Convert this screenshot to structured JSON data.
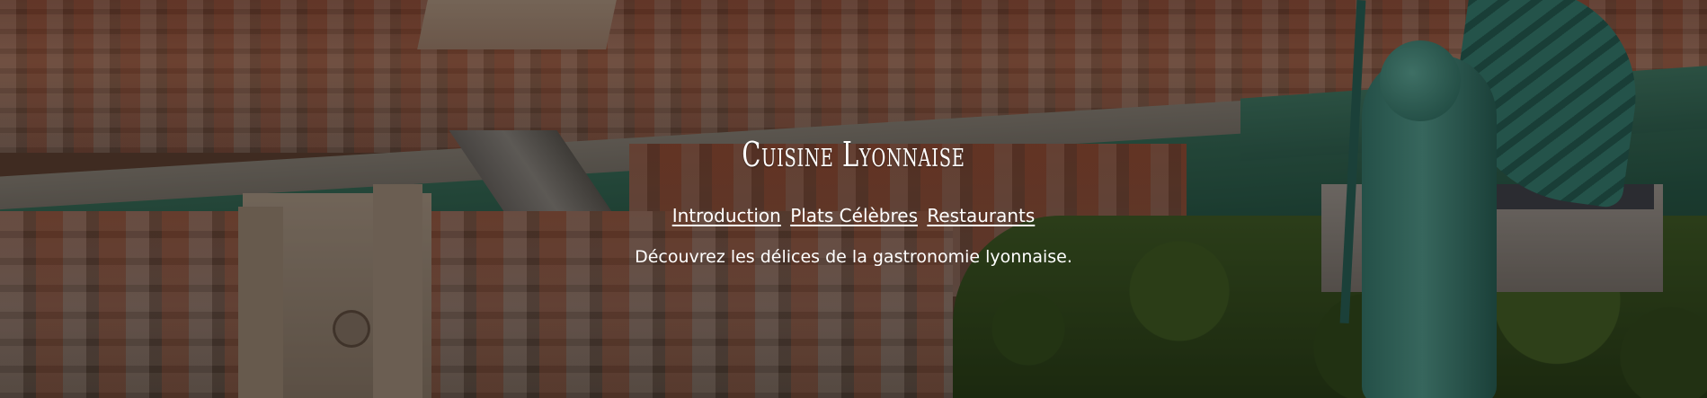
{
  "header": {
    "title": "Cuisine Lyonnaise",
    "nav": [
      {
        "label": "Introduction"
      },
      {
        "label": "Plats Célèbres"
      },
      {
        "label": "Restaurants"
      }
    ],
    "tagline": "Découvrez les délices de la gastronomie lyonnaise."
  },
  "background": {
    "overlay_color": "#000000",
    "text_color": "#ffffff"
  }
}
